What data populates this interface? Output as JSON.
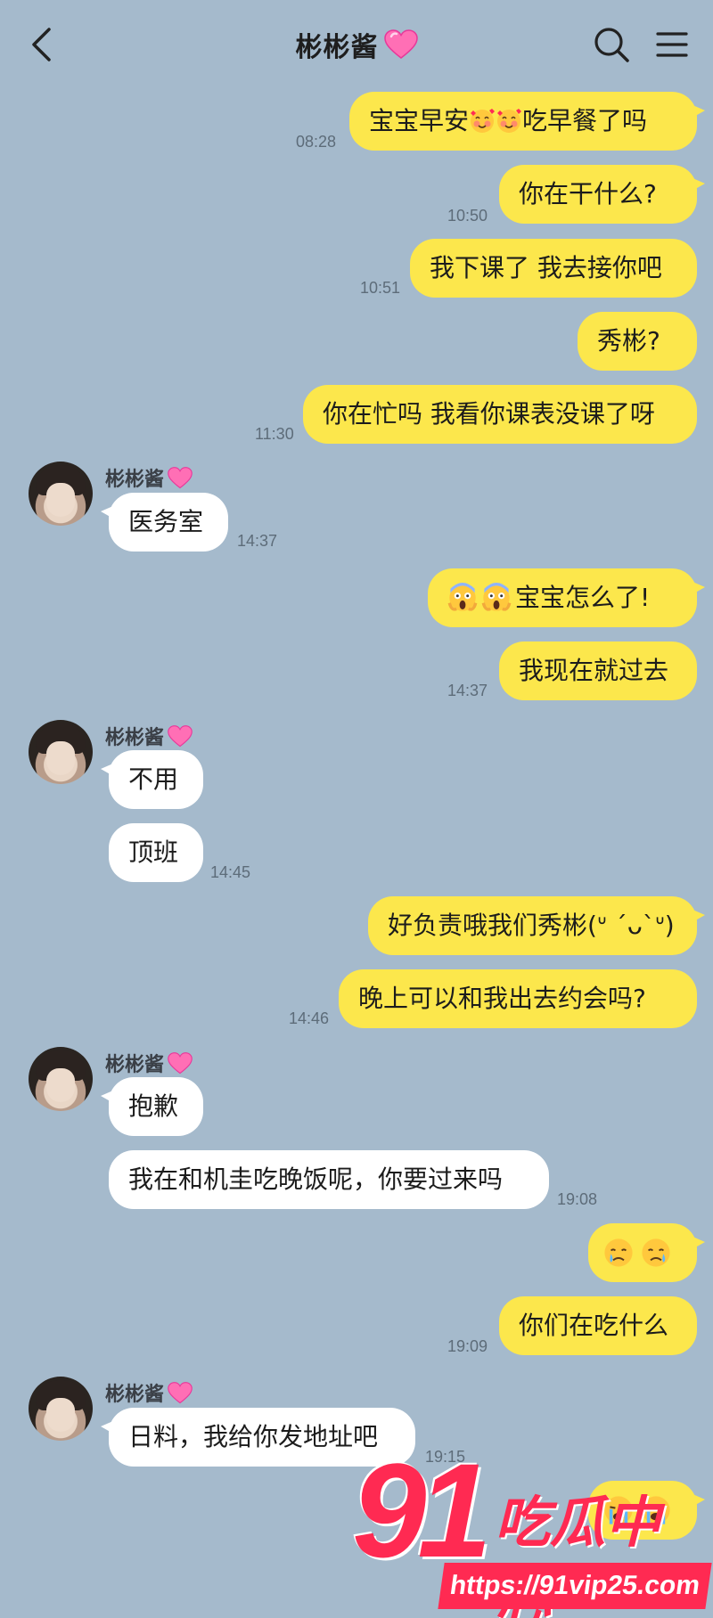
{
  "header": {
    "title": "彬彬酱",
    "back_icon": "chevron-left-icon",
    "title_icon": "pink-heart-icon",
    "search_icon": "search-icon",
    "menu_icon": "hamburger-menu-icon"
  },
  "sender_name": "彬彬酱",
  "messages": [
    {
      "text": "宝宝早安",
      "text2": "吃早餐了吗",
      "time": "08:28"
    },
    {
      "text": "你在干什么?",
      "time": "10:50"
    },
    {
      "text": "我下课了 我去接你吧",
      "time": "10:51"
    },
    {
      "text": "秀彬?"
    },
    {
      "text": "你在忙吗 我看你课表没课了呀",
      "time": "11:30"
    },
    {
      "text": "医务室",
      "time": "14:37"
    },
    {
      "text": "宝宝怎么了!"
    },
    {
      "text": "我现在就过去",
      "time": "14:37"
    },
    {
      "text": "不用"
    },
    {
      "text": "顶班",
      "time": "14:45"
    },
    {
      "text": "好负责哦我们秀彬(ᐡ ´ᴗ`ᐡ)"
    },
    {
      "text": "晚上可以和我出去约会吗?",
      "time": "14:46"
    },
    {
      "text": "抱歉"
    },
    {
      "text": "我在和机圭吃晚饭呢，你要过来吗",
      "time": "19:08"
    },
    {
      "text": "",
      "emoji": "crying-face-icon"
    },
    {
      "text": "你们在吃什么",
      "time": "19:09"
    },
    {
      "text": "日料，我给你发地址吧",
      "time": "19:15"
    },
    {
      "text": "",
      "emoji": "loudly-crying-face-icon"
    }
  ],
  "watermark": {
    "number": "91",
    "text": "吃瓜中心",
    "url": "https://91vip25.com"
  },
  "colors": {
    "background": "#a5bacc",
    "outgoing_bubble": "#fce74c",
    "incoming_bubble": "#ffffff",
    "watermark": "#ff2a52"
  }
}
